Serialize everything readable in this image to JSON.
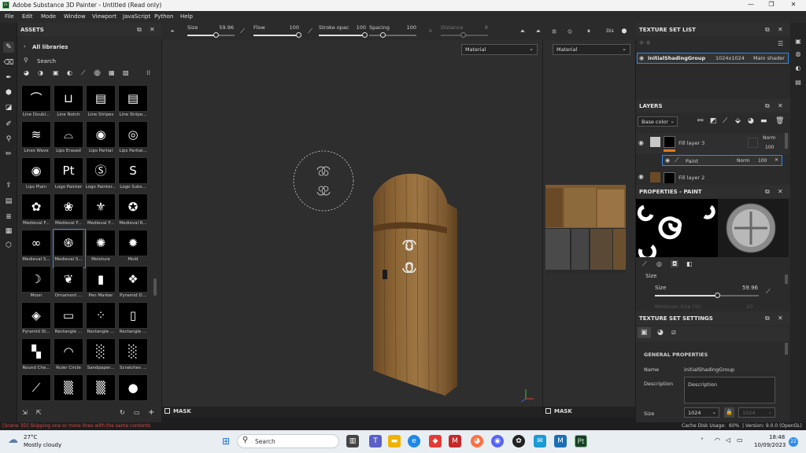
{
  "window": {
    "title": "Adobe Substance 3D Painter - Untitled (Read only)",
    "logo": "Pt",
    "minimize": "—",
    "maximize": "❐",
    "close": "✕"
  },
  "menu": [
    "File",
    "Edit",
    "Mode",
    "Window",
    "Viewport",
    "JavaScript",
    "Python",
    "Help"
  ],
  "toolbar": {
    "size_label": "Size",
    "size_value": "59.96",
    "size_fill": 0.6,
    "flow_label": "Flow",
    "flow_value": "100",
    "flow_fill": 1.0,
    "stroke_label": "Stroke opac",
    "stroke_value": "100",
    "stroke_fill": 1.0,
    "spacing_label": "Spacing",
    "spacing_value": "100",
    "distance_label": "Distance",
    "distance_value": "8",
    "mode_label": "Dis"
  },
  "assets": {
    "title": "ASSETS",
    "all_libraries": "All libraries",
    "search_placeholder": "Search",
    "tiles": [
      {
        "label": "Line Doubl...",
        "glyph": "⌒"
      },
      {
        "label": "Line Notch",
        "glyph": "⊔"
      },
      {
        "label": "Line Stripes",
        "glyph": "▤"
      },
      {
        "label": "Line Stripe...",
        "glyph": "▤"
      },
      {
        "label": "Lines Wave",
        "glyph": "≋"
      },
      {
        "label": "Lips Erased",
        "glyph": "⌓"
      },
      {
        "label": "Lips Partial",
        "glyph": "◉"
      },
      {
        "label": "Lips Partial...",
        "glyph": "◎"
      },
      {
        "label": "Lips Plain",
        "glyph": "◉"
      },
      {
        "label": "Logo Painter",
        "glyph": "Pt"
      },
      {
        "label": "Logo Painter...",
        "glyph": "Ⓢ"
      },
      {
        "label": "Logo Subs...",
        "glyph": "S"
      },
      {
        "label": "Medieval F...",
        "glyph": "✿"
      },
      {
        "label": "Medieval F...",
        "glyph": "❀"
      },
      {
        "label": "Medieval F...",
        "glyph": "⚜"
      },
      {
        "label": "Medieval R...",
        "glyph": "✪"
      },
      {
        "label": "Medieval S...",
        "glyph": "∞"
      },
      {
        "label": "Medieval S...",
        "glyph": "֍"
      },
      {
        "label": "Moisture",
        "glyph": "✺"
      },
      {
        "label": "Mold",
        "glyph": "✹"
      },
      {
        "label": "Moon",
        "glyph": "☽"
      },
      {
        "label": "Ornament ...",
        "glyph": "❦"
      },
      {
        "label": "Pen Marker",
        "glyph": "▮"
      },
      {
        "label": "Pyramid D...",
        "glyph": "❖"
      },
      {
        "label": "Pyramid St...",
        "glyph": "◈"
      },
      {
        "label": "Rectangle ...",
        "glyph": "▭"
      },
      {
        "label": "Rectangle ...",
        "glyph": "⁘"
      },
      {
        "label": "Rectangle ...",
        "glyph": "▯"
      },
      {
        "label": "Round Che...",
        "glyph": "▚"
      },
      {
        "label": "Ruler Circle",
        "glyph": "◠"
      },
      {
        "label": "Sandpaper...",
        "glyph": "░"
      },
      {
        "label": "Scratches ...",
        "glyph": "░"
      },
      {
        "label": "",
        "glyph": "⟋"
      },
      {
        "label": "",
        "glyph": "▒"
      },
      {
        "label": "",
        "glyph": "▒"
      },
      {
        "label": "",
        "glyph": "●"
      }
    ]
  },
  "viewport": {
    "material_left": "Material",
    "material_right": "Material",
    "mask": "MASK",
    "mask_right": "MASK"
  },
  "texture_set_list": {
    "title": "TEXTURE SET LIST",
    "name": "initialShadingGroup",
    "resolution": "1024x1024",
    "shader": "Main shader"
  },
  "layers": {
    "title": "LAYERS",
    "channel": "Base color",
    "items": [
      {
        "name": "Fill layer 3",
        "blend": "Norm",
        "opacity": "100"
      },
      {
        "name": "Paint",
        "blend": "Norm",
        "opacity": "100"
      },
      {
        "name": "Fill layer 2",
        "blend": "",
        "opacity": ""
      }
    ]
  },
  "properties": {
    "title": "PROPERTIES - PAINT",
    "section": "Size",
    "size_label": "Size",
    "size_value": "59.96",
    "size_fill": 0.6,
    "min_size_label": "Minimum Size (%)",
    "min_size_value": "20"
  },
  "texture_set_settings": {
    "title": "TEXTURE SET SETTINGS",
    "section": "GENERAL PROPERTIES",
    "name_label": "Name",
    "name_value": "initialShadingGroup",
    "description_label": "Description",
    "description_value": "Description",
    "size_label": "Size",
    "size_value": "1024",
    "size_value2": "1024"
  },
  "status": {
    "message": "[Scene 3D] Skipping one or more lines with the same contents",
    "cache": "Cache Disk Usage:",
    "cache_value": "60%",
    "version": "| Version: 9.0.0 (OpenGL)"
  },
  "taskbar": {
    "temp": "27°C",
    "weather": "Mostly cloudy",
    "search": "Search",
    "time": "18:48",
    "date": "10/09/2023",
    "badge": "22",
    "app": "Pt"
  },
  "colors": {
    "accent": "#2d8cf0",
    "panel": "#2b2b2b",
    "viewport": "#2e2e2e",
    "status_error": "#d94a4a"
  }
}
